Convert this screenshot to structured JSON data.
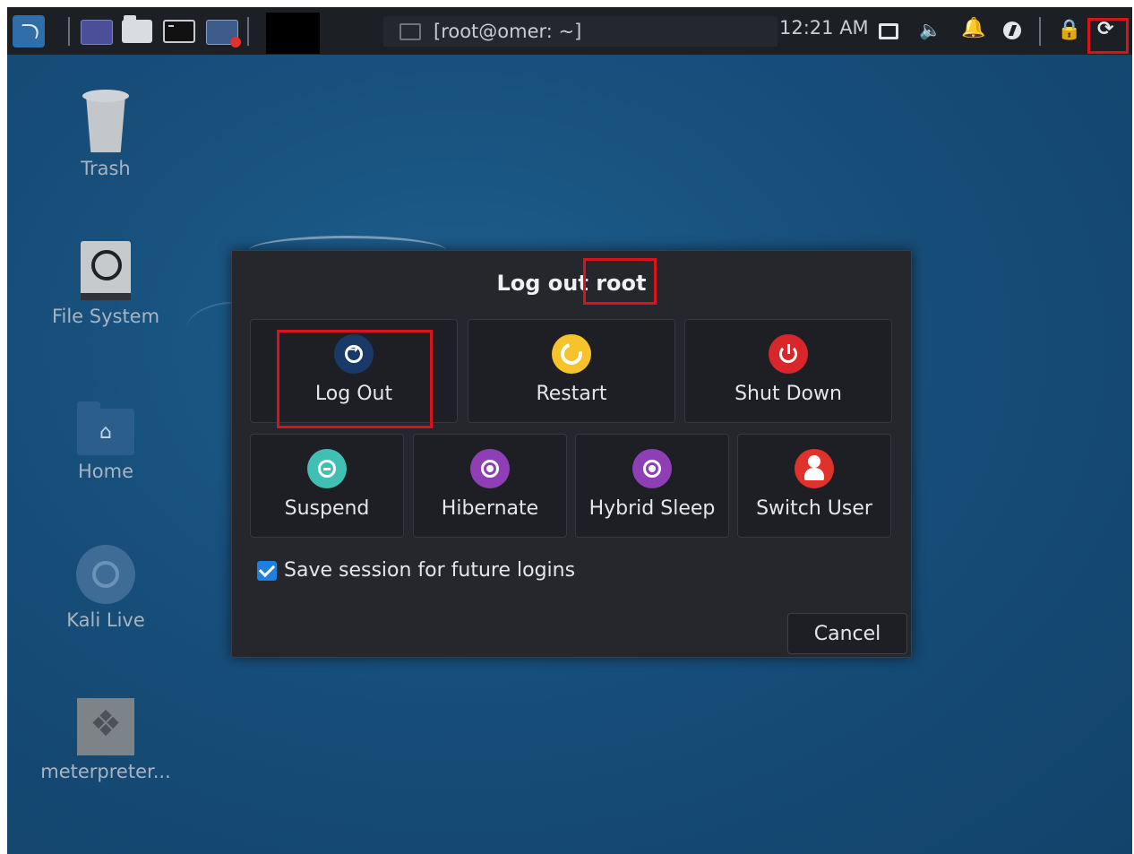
{
  "panel": {
    "window_title": "[root@omer: ~]",
    "clock": "12:21 AM"
  },
  "desktop": {
    "icons": [
      {
        "label": "Trash"
      },
      {
        "label": "File System"
      },
      {
        "label": "Home"
      },
      {
        "label": "Kali Live"
      },
      {
        "label": "meterpreter..."
      }
    ]
  },
  "dialog": {
    "title": "Log out root",
    "actions": [
      {
        "label": "Log Out",
        "icon": "logout-icon",
        "color": "#193a68"
      },
      {
        "label": "Restart",
        "icon": "restart-icon",
        "color": "#f6c42a"
      },
      {
        "label": "Shut Down",
        "icon": "power-icon",
        "color": "#d8262a"
      },
      {
        "label": "Suspend",
        "icon": "suspend-icon",
        "color": "#40bfb5"
      },
      {
        "label": "Hibernate",
        "icon": "hibernate-icon",
        "color": "#8f3fb6"
      },
      {
        "label": "Hybrid Sleep",
        "icon": "hybrid-sleep-icon",
        "color": "#8f3fb6"
      },
      {
        "label": "Switch User",
        "icon": "switch-user-icon",
        "color": "#e0312b"
      }
    ],
    "save_session": {
      "label": "Save session for future logins",
      "checked": true
    },
    "cancel_label": "Cancel"
  },
  "colors": {
    "highlight": "#d9121b",
    "checkbox": "#1f7fde",
    "desktop_bg": "#174e7a"
  }
}
